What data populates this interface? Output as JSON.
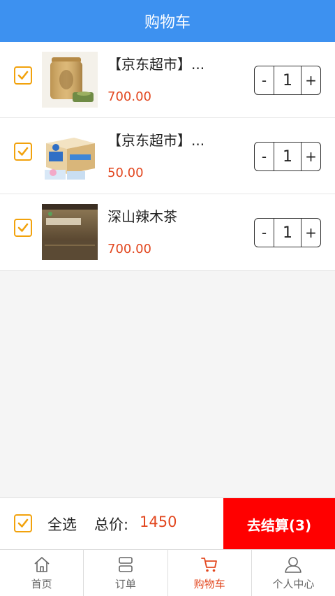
{
  "header": {
    "title": "购物车"
  },
  "cart": {
    "items": [
      {
        "name": "【京东超市】...",
        "price": "700.00",
        "quantity": "1",
        "minus": "-",
        "plus": "+"
      },
      {
        "name": "【京东超市】...",
        "price": "50.00",
        "quantity": "1",
        "minus": "-",
        "plus": "+"
      },
      {
        "name": "深山辣木茶",
        "price": "700.00",
        "quantity": "1",
        "minus": "-",
        "plus": "+"
      }
    ]
  },
  "summary": {
    "select_all_label": "全选",
    "total_label": "总价:",
    "total_value": "1450",
    "checkout_label": "去结算(3)"
  },
  "tabbar": {
    "tabs": [
      {
        "label": "首页",
        "icon": "home-icon"
      },
      {
        "label": "订单",
        "icon": "order-icon"
      },
      {
        "label": "购物车",
        "icon": "cart-icon",
        "active": true
      },
      {
        "label": "个人中心",
        "icon": "user-icon"
      }
    ]
  },
  "colors": {
    "header_bg": "#3d91f0",
    "accent_red": "#e2471f",
    "checkout_bg": "#ff0000",
    "checkbox": "#f2a20c"
  }
}
